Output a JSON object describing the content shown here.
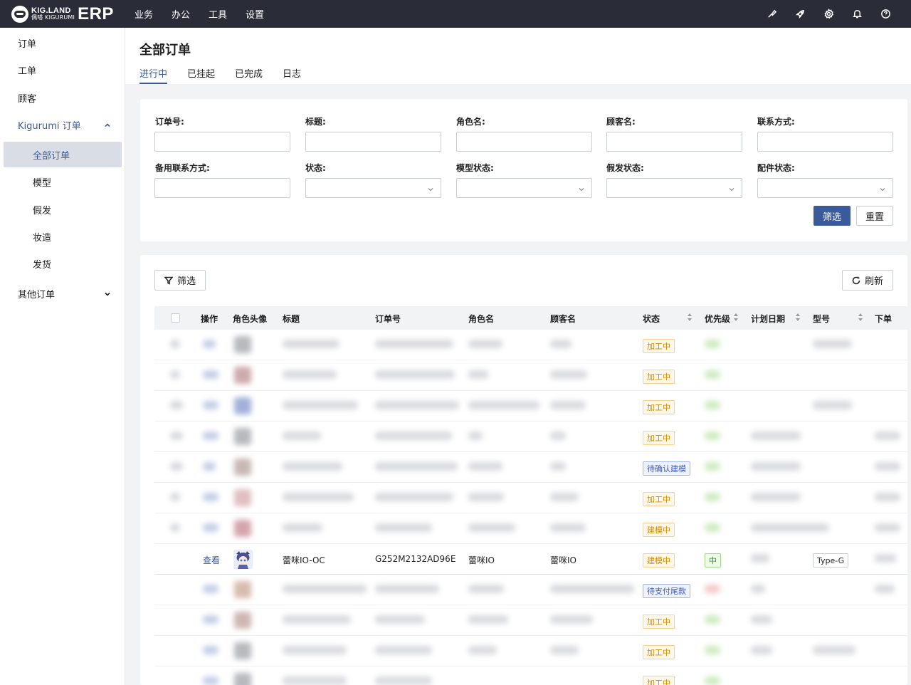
{
  "brand": {
    "line1": "KIG.LAND",
    "line2": "偶嗒 KIGURUMI",
    "product": "ERP"
  },
  "topnav": [
    "业务",
    "办公",
    "工具",
    "设置"
  ],
  "top_icons": [
    "brush-icon",
    "rocket-icon",
    "gear-icon",
    "bell-icon",
    "help-icon"
  ],
  "sidebar": {
    "items": [
      {
        "label": "订单"
      },
      {
        "label": "工单"
      },
      {
        "label": "顾客"
      },
      {
        "label": "Kigurumi 订单"
      },
      {
        "label": "全部订单"
      },
      {
        "label": "模型"
      },
      {
        "label": "假发"
      },
      {
        "label": "妆造"
      },
      {
        "label": "发货"
      },
      {
        "label": "其他订单"
      }
    ]
  },
  "page": {
    "title": "全部订单",
    "tabs": [
      "进行中",
      "已挂起",
      "已完成",
      "日志"
    ],
    "active_tab": "进行中"
  },
  "filters": {
    "fields": [
      {
        "label": "订单号:",
        "value": ""
      },
      {
        "label": "标题:",
        "value": ""
      },
      {
        "label": "角色名:",
        "value": ""
      },
      {
        "label": "顾客名:",
        "value": ""
      },
      {
        "label": "联系方式:",
        "value": ""
      },
      {
        "label": "备用联系方式:",
        "value": ""
      },
      {
        "label": "状态:",
        "value": ""
      },
      {
        "label": "模型状态:",
        "value": ""
      },
      {
        "label": "假发状态:",
        "value": ""
      },
      {
        "label": "配件状态:",
        "value": ""
      }
    ],
    "submit_label": "筛选",
    "reset_label": "重置"
  },
  "table": {
    "filter_button": "筛选",
    "refresh_button": "刷新",
    "columns": [
      "操作",
      "角色头像",
      "标题",
      "订单号",
      "角色名",
      "顾客名",
      "状态",
      "优先级",
      "计划日期",
      "型号",
      "下单"
    ],
    "status_tags": [
      "加工中",
      "加工中",
      "加工中",
      "加工中",
      "待确认建模",
      "加工中",
      "建模中",
      "建模中",
      "待支付尾款",
      "加工中",
      "加工中",
      "加工中"
    ],
    "visible_row": {
      "action": "查看",
      "title": "蕾咪IO-OC",
      "order_no": "G252M2132AD96E",
      "role_name": "蕾咪IO",
      "customer": "蕾咪IO",
      "status": "建模中",
      "priority": "中",
      "model": "Type-G"
    }
  },
  "colors": {
    "topbar": "#2a2d38",
    "primary": "#3a5a9b",
    "tag_orange": "#d68a00",
    "tag_blue": "#3a5ac0",
    "tag_green": "#2e9a1f"
  }
}
